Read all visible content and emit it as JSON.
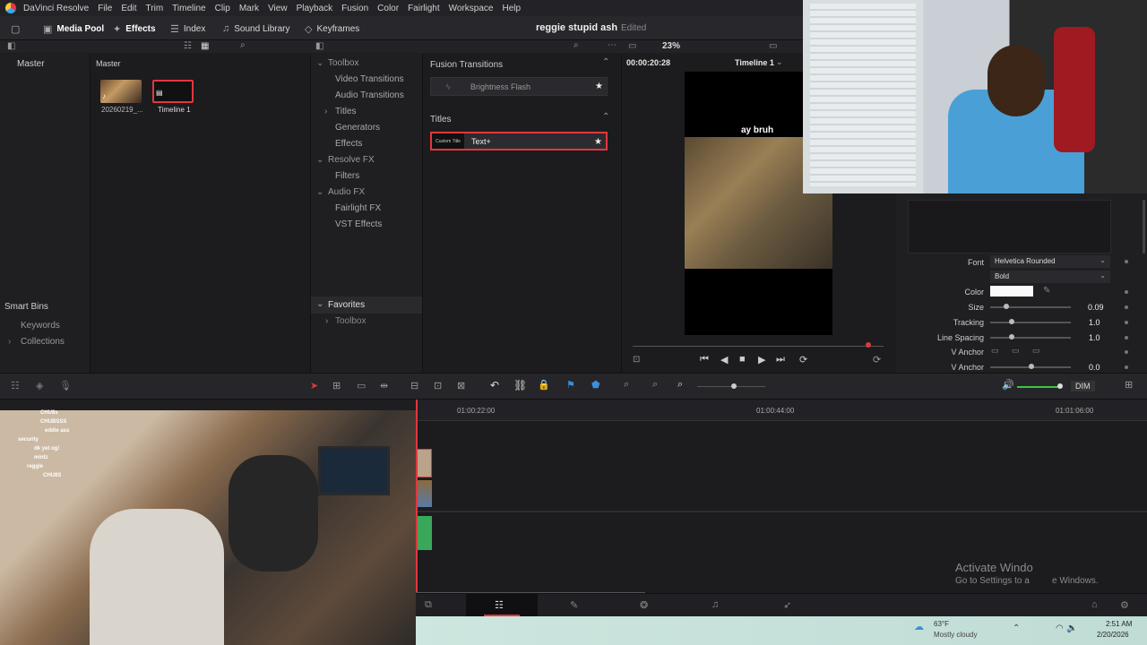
{
  "menubar": {
    "app": "DaVinci Resolve",
    "items": [
      "File",
      "Edit",
      "Trim",
      "Timeline",
      "Clip",
      "Mark",
      "View",
      "Playback",
      "Fusion",
      "Color",
      "Fairlight",
      "Workspace",
      "Help"
    ]
  },
  "toolbar": {
    "media_pool": "Media Pool",
    "effects": "Effects",
    "index": "Index",
    "sound_library": "Sound Library",
    "keyframes": "Keyframes",
    "project_title": "reggie stupid ash",
    "project_status": "Edited",
    "zoom": "23%"
  },
  "media_pool": {
    "master_left": "Master",
    "master_right": "Master",
    "clips": [
      {
        "label": "20260219_..."
      },
      {
        "label": "Timeline 1"
      }
    ],
    "smart_bins": "Smart Bins",
    "keywords": "Keywords",
    "collections": "Collections"
  },
  "effects_tree": {
    "toolbox": "Toolbox",
    "video_transitions": "Video Transitions",
    "audio_transitions": "Audio Transitions",
    "titles": "Titles",
    "generators": "Generators",
    "effects": "Effects",
    "resolve_fx": "Resolve FX",
    "filters": "Filters",
    "audio_fx": "Audio FX",
    "fairlight_fx": "Fairlight FX",
    "vst_effects": "VST Effects",
    "favorites": "Favorites",
    "fav_toolbox": "Toolbox"
  },
  "effects_list": {
    "fusion_transitions": "Fusion Transitions",
    "brightness_flash": "Brightness Flash",
    "titles_header": "Titles",
    "custom_title_thumb": "Custom Title",
    "text_plus": "Text+"
  },
  "viewer": {
    "timecode": "00:00:20:28",
    "timeline_name": "Timeline 1",
    "overlay_text": "ay bruh"
  },
  "inspector": {
    "font_label": "Font",
    "font_value": "Helvetica Rounded",
    "style_value": "Bold",
    "color_label": "Color",
    "size_label": "Size",
    "size_value": "0.09",
    "tracking_label": "Tracking",
    "tracking_value": "1.0",
    "line_spacing_label": "Line Spacing",
    "line_spacing_value": "1.0",
    "v_anchor_label": "V Anchor",
    "v_anchor2_label": "V Anchor",
    "v_anchor2_value": "0.0"
  },
  "timeline": {
    "dim": "DIM",
    "ruler": [
      "01:00:22:00",
      "01:00:44:00",
      "01:01:06:00"
    ]
  },
  "overlay": {
    "activate_title": "Activate Windo",
    "activate_sub": "Go to Settings to a",
    "activate_sub2": "e Windows."
  },
  "taskbar": {
    "temp": "63°F",
    "weather": "Mostly cloudy",
    "time": "2:51 AM",
    "date": "2/20/2026"
  },
  "chat": {
    "lines": [
      {
        "user": "",
        "msg": "CHU8s"
      },
      {
        "user": "",
        "msg": "CHUBSSS"
      },
      {
        "user": "",
        "msg": "eddie ass"
      },
      {
        "user": "",
        "msg": "security"
      },
      {
        "user": "",
        "msg": "dk yet og!"
      },
      {
        "user": "",
        "msg": "mintz"
      },
      {
        "user": "",
        "msg": "reggie"
      },
      {
        "user": "",
        "msg": "CHU8S"
      }
    ]
  },
  "colors": {
    "accent_red": "#e0383e",
    "playhead": "#e0383e"
  }
}
